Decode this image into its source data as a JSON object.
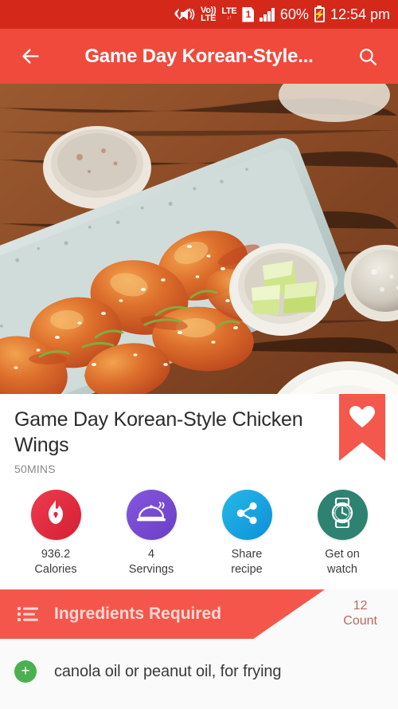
{
  "status_bar": {
    "mute_icon": "mute-vibrate-icon",
    "volte": {
      "top": "Vo))",
      "bottom": "LTE"
    },
    "lte": {
      "top": "LTE",
      "bottom": "↓↑"
    },
    "sim": "1",
    "signal_icon": "signal-bars-icon",
    "battery_percent": "60%",
    "battery_icon": "battery-charging-icon",
    "time": "12:54 pm"
  },
  "app_bar": {
    "back_icon": "back-arrow-icon",
    "title": "Game Day Korean-Style...",
    "search_icon": "search-icon"
  },
  "hero": {
    "alt": "Korean-style fried chicken wings on a pale blue ceramic platter with lime wedges, beer glasses on a wooden table"
  },
  "recipe": {
    "title": "Game Day Korean-Style Chicken Wings",
    "time": "50MINS",
    "favorite_icon": "heart-bookmark-icon"
  },
  "actions": [
    {
      "name": "calories",
      "icon": "flame-icon",
      "value": "936.2",
      "label": "Calories",
      "color": "#e02a3e"
    },
    {
      "name": "servings",
      "icon": "serving-dome-icon",
      "value": "4",
      "label": "Servings",
      "color": "#7a4bd4"
    },
    {
      "name": "share",
      "icon": "share-icon",
      "value": "Share",
      "label": "recipe",
      "color": "#13a0de"
    },
    {
      "name": "watch",
      "icon": "watch-icon",
      "value": "Get on",
      "label": "watch",
      "color": "#2d8272"
    }
  ],
  "ingredients_section": {
    "list_icon": "format-list-icon",
    "title": "Ingredients Required",
    "count": "12",
    "count_label": "Count"
  },
  "ingredients": [
    {
      "add_icon": "plus-circle-icon",
      "text": "canola oil or peanut oil, for frying"
    }
  ]
}
